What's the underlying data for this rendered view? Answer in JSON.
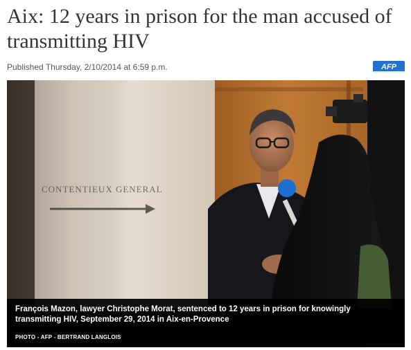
{
  "article": {
    "headline": "Aix: 12 years in prison for the man accused of transmitting HIV",
    "published": "Published Thursday, 2/10/2014 at 6:59 p.m.",
    "agency_logo": "AFP",
    "brand_color": "#1f73c8"
  },
  "photo": {
    "sign_text": "CONTENTIEUX GENERAL",
    "caption": "François Mazon, lawyer Christophe Morat, sentenced to 12 years in prison for knowingly transmitting HIV, September 29, 2014 in Aix-en-Provence",
    "credit": "PHOTO - AFP - BERTRAND LANGLOIS"
  }
}
